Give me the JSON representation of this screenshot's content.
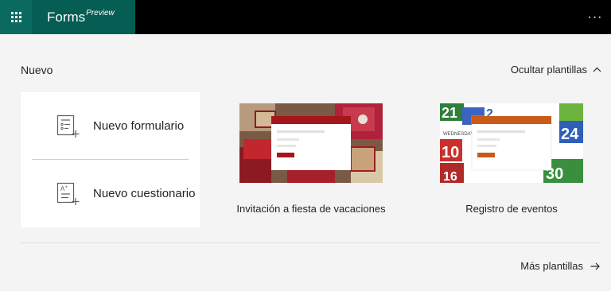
{
  "header": {
    "app_name": "Forms",
    "app_tag": "Preview",
    "more_label": "···"
  },
  "main": {
    "section_title": "Nuevo",
    "hide_templates_label": "Ocultar plantillas",
    "new_items": [
      {
        "label": "Nuevo formulario",
        "icon": "form-icon"
      },
      {
        "label": "Nuevo cuestionario",
        "icon": "quiz-icon"
      }
    ],
    "templates": [
      {
        "title": "Invitación a fiesta de vacaciones",
        "accent": "#a4161a"
      },
      {
        "title": "Registro de eventos",
        "accent": "#c85a1a"
      }
    ],
    "more_templates_label": "Más plantillas"
  },
  "colors": {
    "brand_dark": "#055d53",
    "brand": "#0b6a5f",
    "topbar": "#000000"
  }
}
